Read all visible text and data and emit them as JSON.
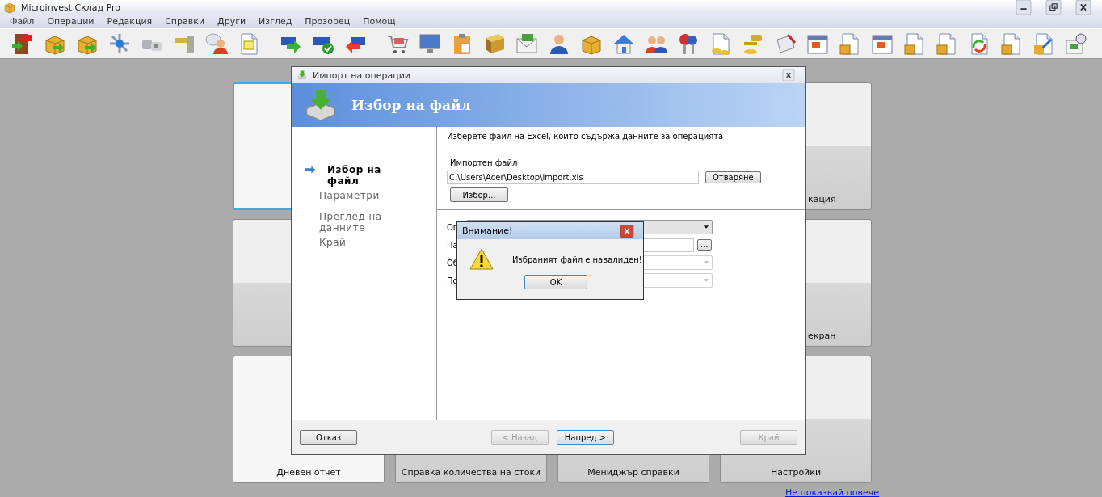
{
  "window": {
    "title": "Microinvest Склад Pro"
  },
  "menu": [
    "Файл",
    "Операции",
    "Редакция",
    "Справки",
    "Други",
    "Изглед",
    "Прозорец",
    "Помощ"
  ],
  "tiles": [
    {
      "selected": true,
      "highlighted": true
    },
    {
      "label": "кация",
      "selected": false,
      "highlighted": false
    },
    {
      "selected": false,
      "highlighted": false
    },
    {
      "label": "екран",
      "selected": false,
      "highlighted": false
    },
    {
      "label": "Дневен отчет",
      "selected": false,
      "highlighted": true
    },
    {
      "label": "Справка количества на стоки",
      "selected": false,
      "highlighted": false
    },
    {
      "label": "Мениджър справки",
      "selected": false,
      "highlighted": false
    },
    {
      "label": "Настройки",
      "selected": false,
      "highlighted": false
    }
  ],
  "link": "Не показвай повече",
  "dialog": {
    "title": "Импорт на операции",
    "heading": "Избор на файл",
    "steps": [
      {
        "label": "Избор на файл",
        "selected": true
      },
      {
        "label": "Параметри",
        "selected": false
      },
      {
        "label": "Преглед на данните",
        "selected": false
      },
      {
        "label": "Край",
        "selected": false
      }
    ],
    "instruction": "Изберете файл на Excel, който съдържа данните за операцията",
    "file_label": "Импортен файл",
    "file_value": "C:\\Users\\Acer\\Desktop\\import.xls",
    "open_button": "Отваряне",
    "browse_button": "Избор...",
    "rows": [
      {
        "kind": "combo",
        "label": "Оп",
        "disabled": false
      },
      {
        "kind": "browse",
        "label": "Па",
        "button": "..."
      },
      {
        "kind": "combo",
        "label": "Об",
        "disabled": true
      },
      {
        "kind": "combo",
        "label": "По",
        "disabled": true
      }
    ],
    "buttons": [
      {
        "label": "Отказ",
        "disabled": false,
        "default": false
      },
      {
        "label": "< Назад",
        "disabled": true,
        "default": false
      },
      {
        "label": "Напред >",
        "disabled": false,
        "default": true
      },
      {
        "label": "Край",
        "disabled": true,
        "default": false
      }
    ]
  },
  "message": {
    "title": "Внимание!",
    "text": "Избраният файл е навалиден!",
    "button": "OK"
  }
}
